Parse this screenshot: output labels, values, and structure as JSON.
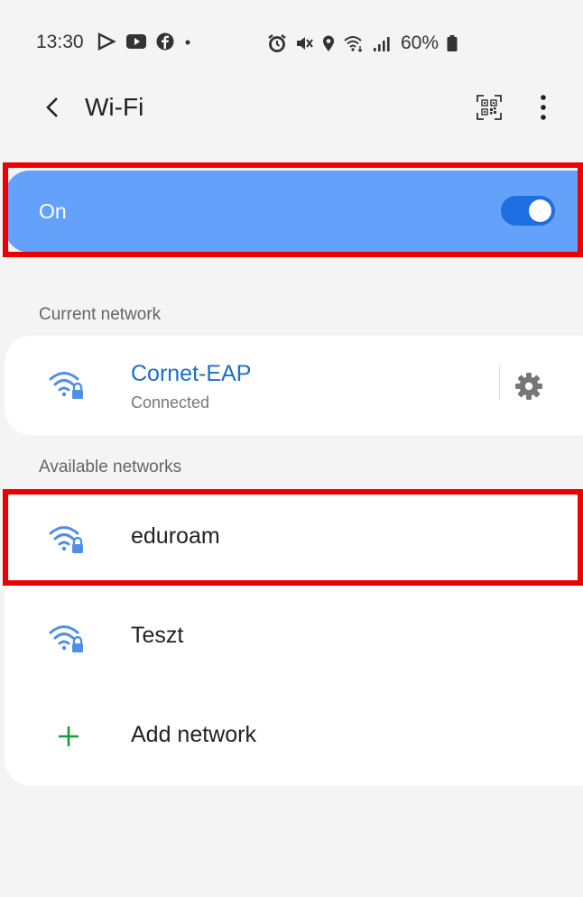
{
  "status_bar": {
    "time": "13:30",
    "battery": "60%"
  },
  "appbar": {
    "title": "Wi-Fi"
  },
  "wifi_toggle": {
    "label": "On",
    "enabled": true
  },
  "current_network": {
    "section_title": "Current network",
    "ssid": "Cornet-EAP",
    "status": "Connected"
  },
  "available_networks": {
    "section_title": "Available networks",
    "networks": [
      {
        "ssid": "eduroam"
      },
      {
        "ssid": "Teszt"
      }
    ],
    "add_label": "Add network"
  },
  "colors": {
    "accent": "#64a1fb",
    "toggle": "#1c6fe0",
    "ssid_connected": "#1d6ec8",
    "add_icon": "#1d9a3c",
    "highlight": "#ee0000"
  }
}
